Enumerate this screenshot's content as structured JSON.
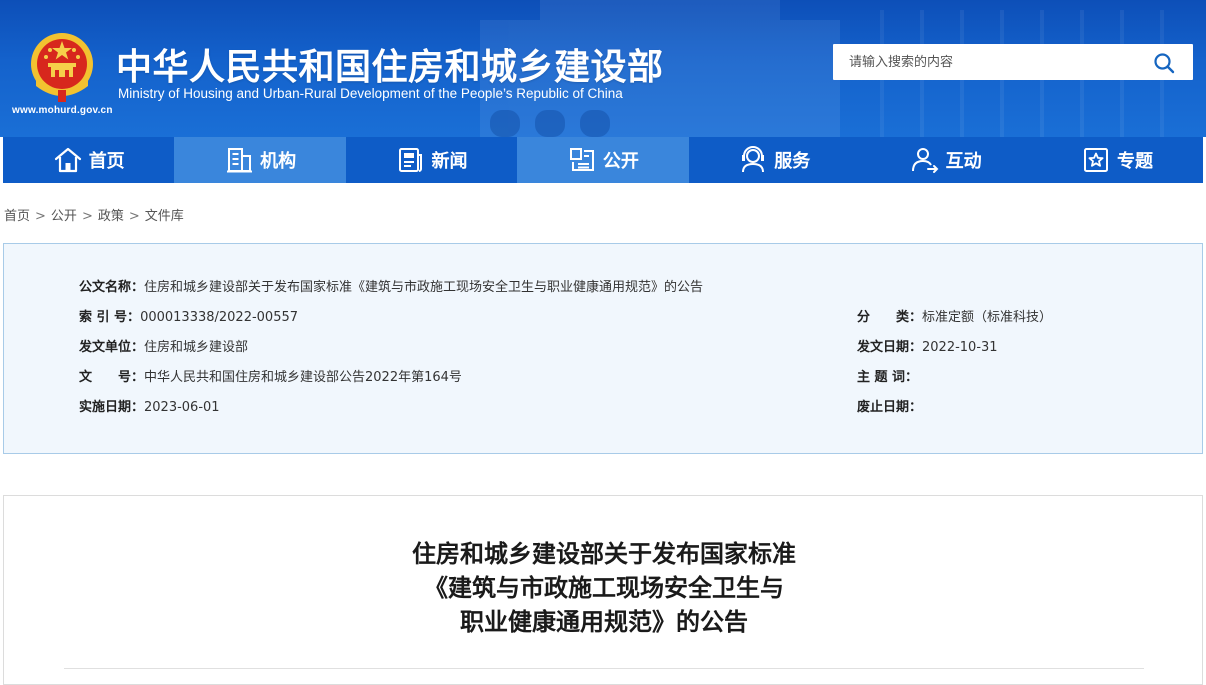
{
  "header": {
    "site_url": "www.mohurd.gov.cn",
    "title_cn": "中华人民共和国住房和城乡建设部",
    "title_en": "Ministry of Housing and Urban-Rural Development of the People’s Republic of China",
    "search_placeholder": "请输入搜索的内容",
    "colors": {
      "banner": "#1462cc",
      "nav": "#0e5cc7",
      "nav_alt": "#3a86dc"
    }
  },
  "nav": [
    {
      "label": "首页",
      "icon": "home-icon"
    },
    {
      "label": "机构",
      "icon": "building-icon"
    },
    {
      "label": "新闻",
      "icon": "news-icon"
    },
    {
      "label": "公开",
      "icon": "disclosure-icon"
    },
    {
      "label": "服务",
      "icon": "service-icon"
    },
    {
      "label": "互动",
      "icon": "interaction-icon"
    },
    {
      "label": "专题",
      "icon": "topic-icon"
    }
  ],
  "breadcrumb": [
    "首页",
    "公开",
    "政策",
    "文件库"
  ],
  "info": {
    "name_label": "公文名称：",
    "name_value": "住房和城乡建设部关于发布国家标准《建筑与市政施工现场安全卫生与职业健康通用规范》的公告",
    "index_label": "索 引 号：",
    "index_value": "000013338/2022-00557",
    "category_label": "分　　类：",
    "category_value": "标准定额（标准科技）",
    "issuer_label": "发文单位：",
    "issuer_value": "住房和城乡建设部",
    "issue_date_label": "发文日期：",
    "issue_date_value": "2022-10-31",
    "docno_label": "文　　号：",
    "docno_value": "中华人民共和国住房和城乡建设部公告2022年第164号",
    "keywords_label": "主 题 词：",
    "keywords_value": "",
    "effective_label": "实施日期：",
    "effective_value": "2023-06-01",
    "expiry_label": "废止日期：",
    "expiry_value": ""
  },
  "article": {
    "title_line1": "住房和城乡建设部关于发布国家标准",
    "title_line2": "《建筑与市政施工现场安全卫生与",
    "title_line3": "职业健康通用规范》的公告"
  }
}
